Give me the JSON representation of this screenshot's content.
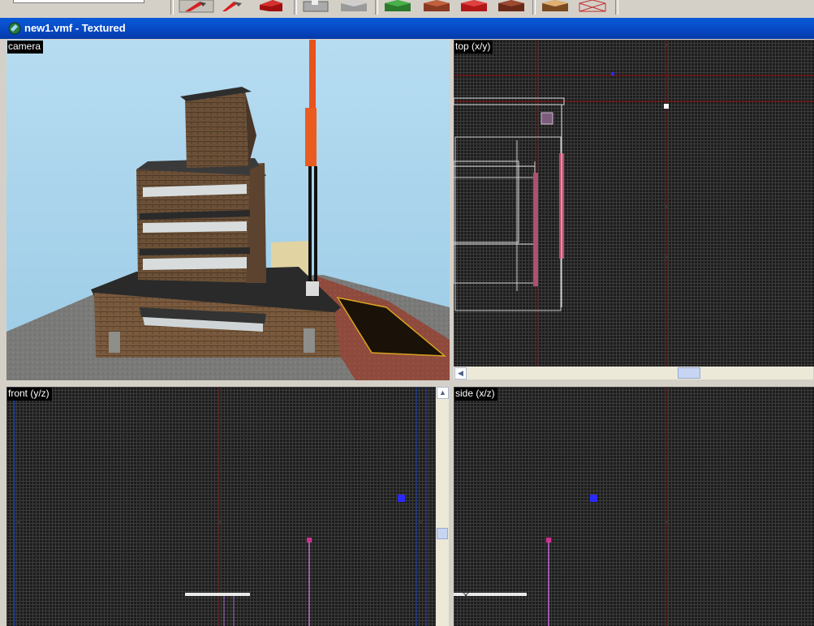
{
  "window": {
    "title": "new1.vmf - Textured"
  },
  "toolbar": {
    "field_value": "",
    "tools": [
      "selection-tool-icon",
      "magnify-tool-icon",
      "camera-tool-icon",
      "entity-tool-icon",
      "block-tool-icon",
      "texture-application-icon",
      "apply-texture-icon",
      "decal-tool-icon",
      "overlay-tool-icon",
      "clipping-tool-icon",
      "vertex-tool-icon"
    ]
  },
  "viewports": {
    "camera": {
      "label": "camera"
    },
    "top": {
      "label": "top (x/y)"
    },
    "front": {
      "label": "front (y/z)"
    },
    "side": {
      "label": "side (x/z)"
    }
  },
  "colors": {
    "title_bar": "#0747c2",
    "viewport_bg": "#1c1c1c",
    "grid_line": "#3c3c3c",
    "axis_line": "#6a1515",
    "sky": "#a9d4ec"
  }
}
